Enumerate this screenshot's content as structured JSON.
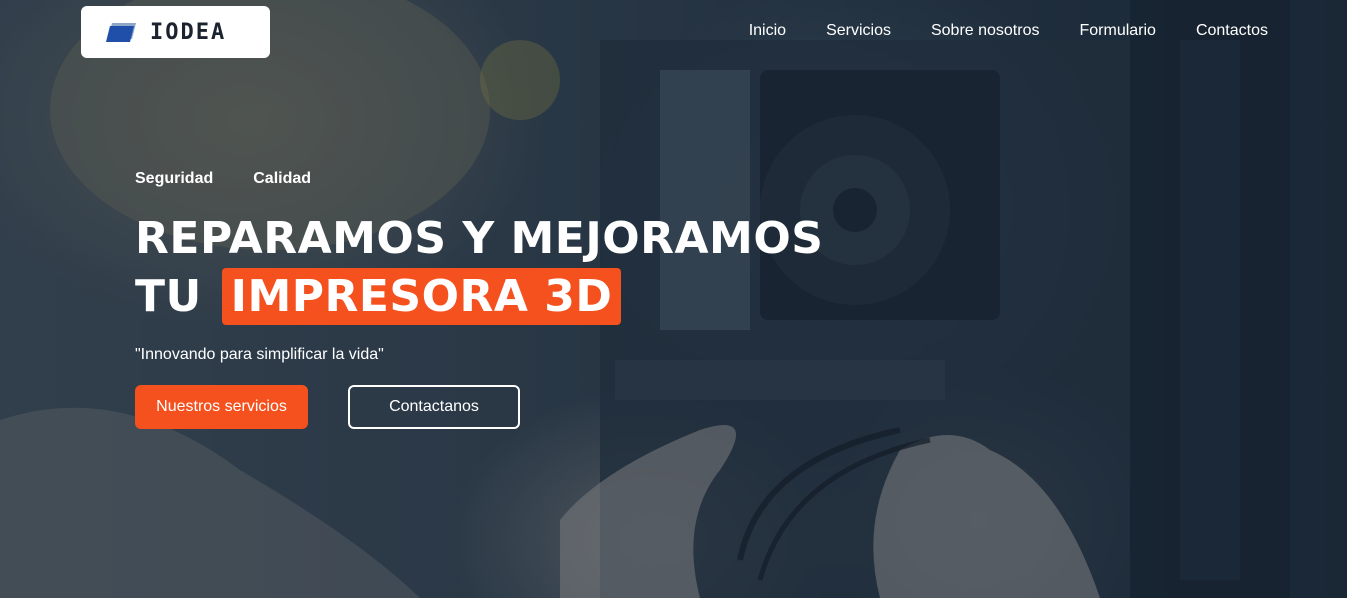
{
  "brand": {
    "logo_text": "IODEA",
    "logo_icon": "stacked-squares-logo-icon",
    "logo_color": "#1f4fa8"
  },
  "nav": {
    "items": [
      {
        "label": "Inicio"
      },
      {
        "label": "Servicios"
      },
      {
        "label": "Sobre nosotros"
      },
      {
        "label": "Formulario"
      },
      {
        "label": "Contactos"
      }
    ]
  },
  "hero": {
    "tags": [
      "Seguridad",
      "Calidad"
    ],
    "headline_line1": "REPARAMOS Y MEJORAMOS",
    "headline_line2_prefix": "TU",
    "headline_highlight": "IMPRESORA 3D",
    "tagline": "\"Innovando para simplificar la vida\"",
    "primary_button": "Nuestros servicios",
    "secondary_button": "Contactanos"
  },
  "colors": {
    "accent": "#f4511e",
    "text": "#ffffff",
    "overlay": "#142332"
  }
}
